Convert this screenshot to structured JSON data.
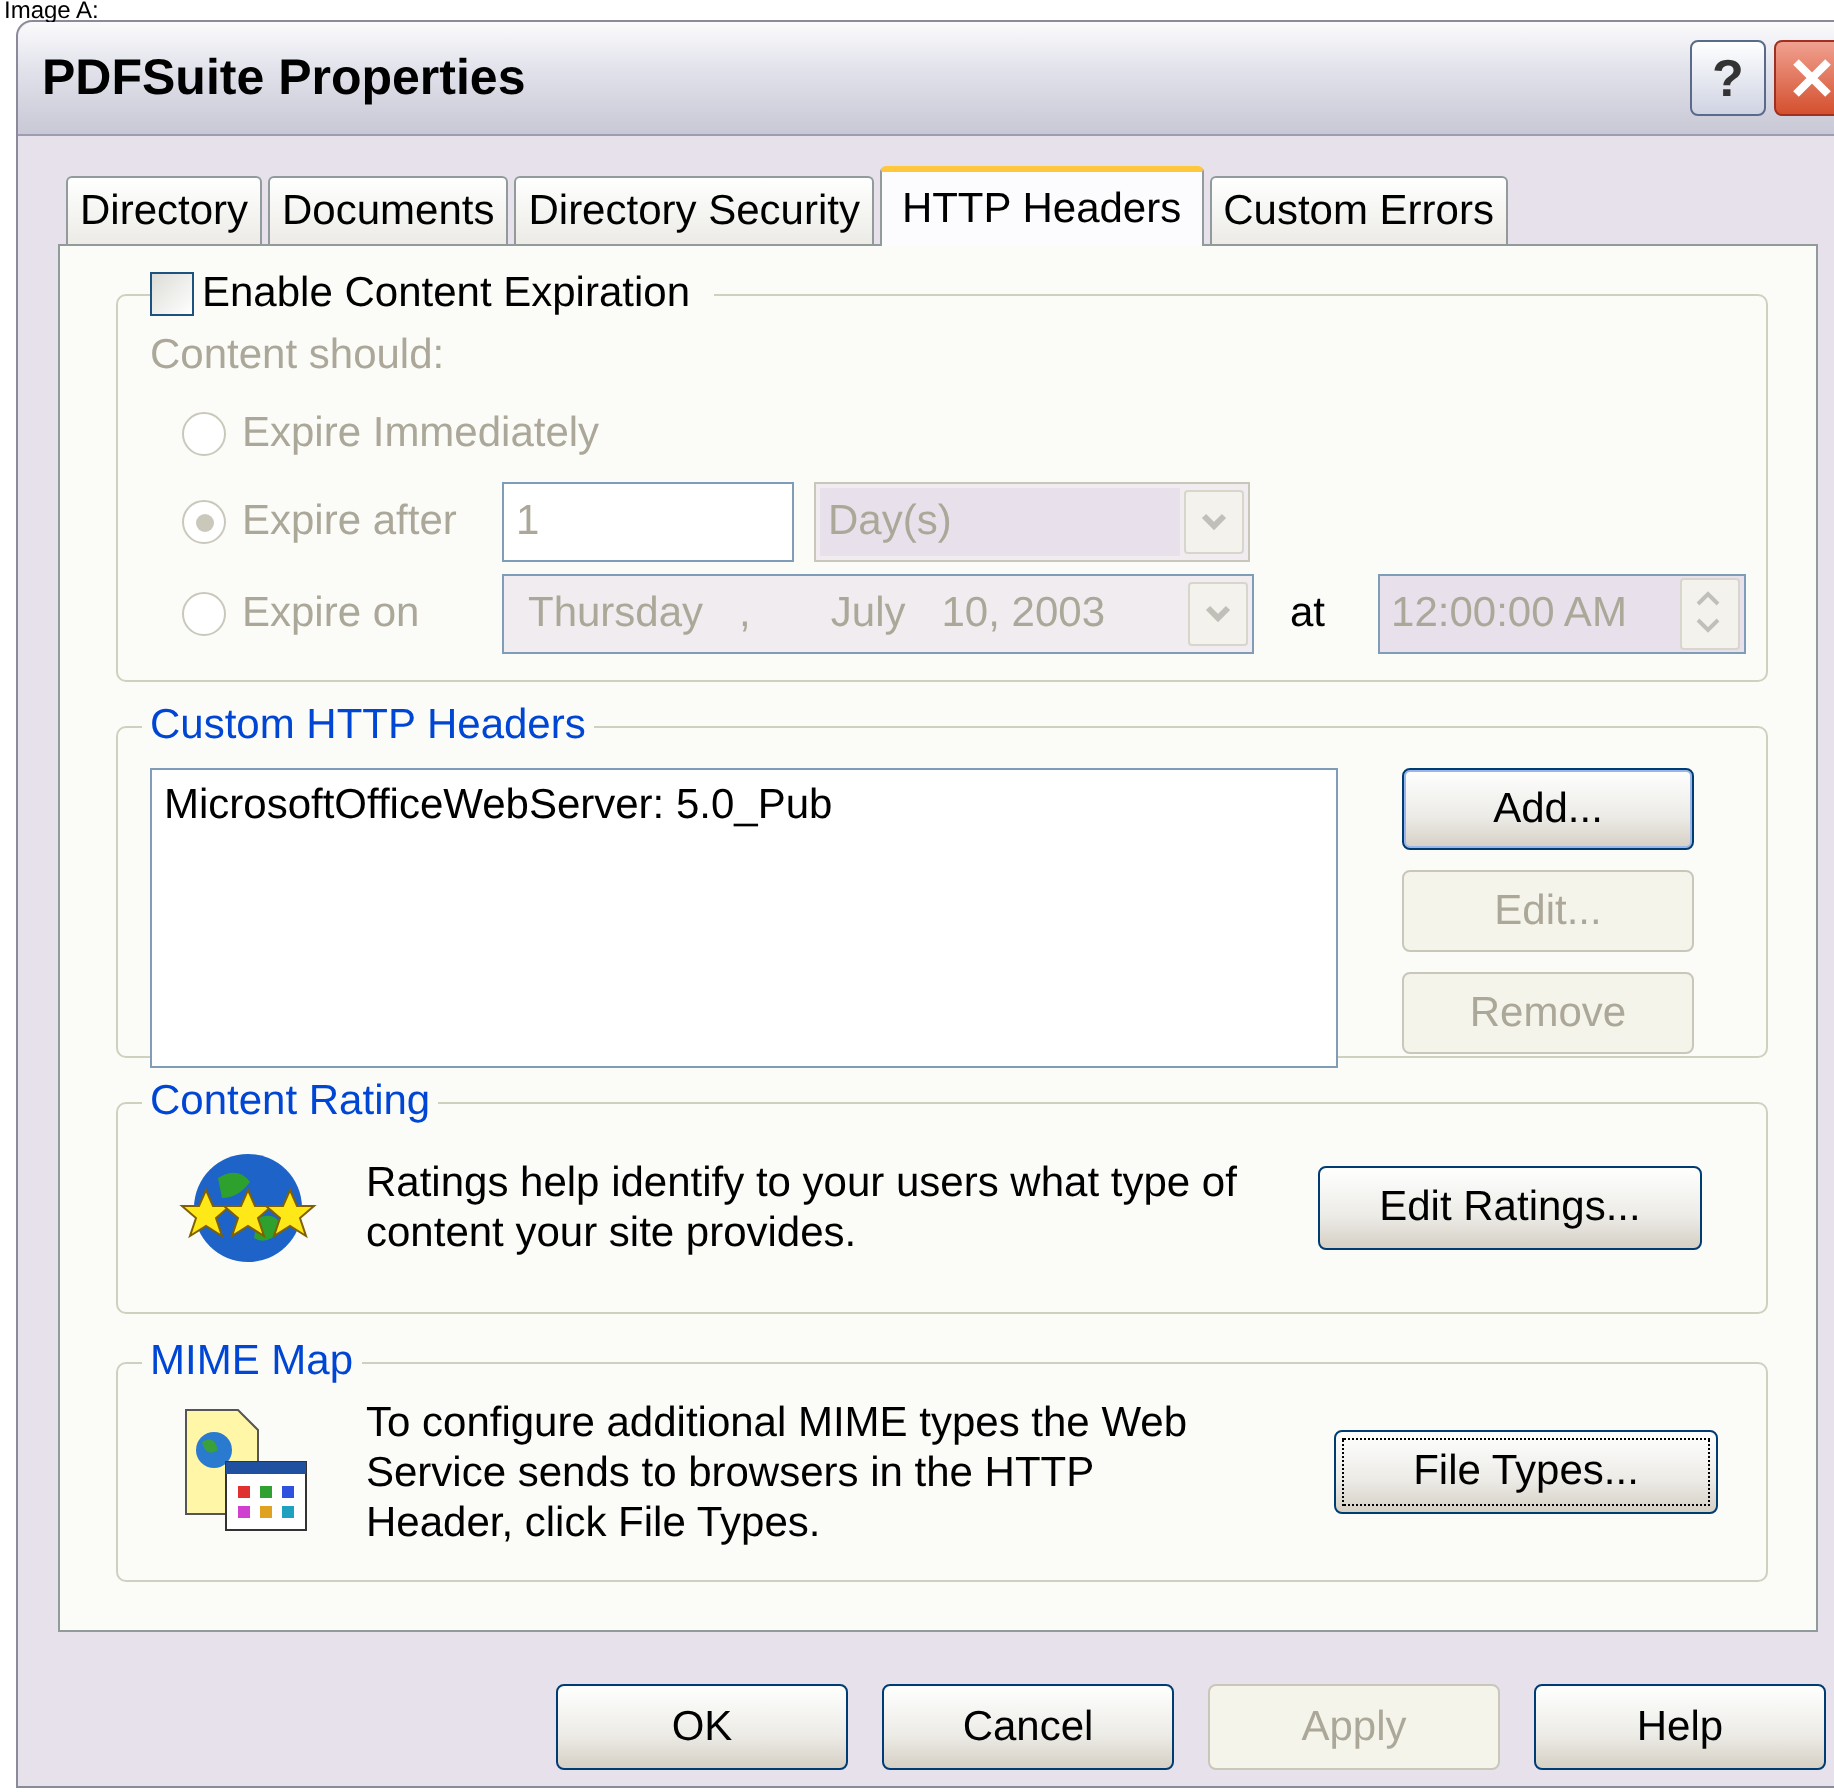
{
  "caption": "Image A:",
  "window": {
    "title": "PDFSuite Properties",
    "controls": [
      {
        "kind": "help",
        "label": "?"
      },
      {
        "kind": "close"
      }
    ]
  },
  "tabs": [
    {
      "label": "Directory",
      "selected": false
    },
    {
      "label": "Documents",
      "selected": false
    },
    {
      "label": "Directory Security",
      "selected": false
    },
    {
      "label": "HTTP Headers",
      "selected": true
    },
    {
      "label": "Custom Errors",
      "selected": false
    }
  ],
  "expiration": {
    "label": "Enable Content Expiration",
    "checked": false,
    "prompt": "Content should:",
    "disabled": true,
    "options": [
      {
        "kind": "plain",
        "label": "Expire Immediately",
        "selected": false
      },
      {
        "kind": "after",
        "label": "Expire after",
        "selected": true,
        "value": "1",
        "unit": "Day(s)"
      },
      {
        "kind": "on",
        "label": "Expire on",
        "selected": false,
        "date": [
          "Thursday",
          ",",
          "July",
          "10, 2003"
        ],
        "at": "at",
        "time": "12:00:00 AM"
      }
    ]
  },
  "headers": {
    "legend": "Custom HTTP Headers",
    "items": [
      "MicrosoftOfficeWebServer: 5.0_Pub"
    ],
    "buttons": [
      {
        "label": "Add...",
        "disabled": false,
        "default": true
      },
      {
        "label": "Edit...",
        "disabled": true,
        "default": false
      },
      {
        "label": "Remove",
        "disabled": true,
        "default": false
      }
    ]
  },
  "rating": {
    "legend": "Content Rating",
    "text": "Ratings help identify to your users what type of content your site provides.",
    "button": {
      "label": "Edit Ratings...",
      "focused": false
    }
  },
  "mime": {
    "legend": "MIME Map",
    "text": "To configure additional MIME types the Web Service sends to browsers in the HTTP Header, click File Types.",
    "button": {
      "label": "File Types...",
      "focused": true
    }
  },
  "footer": [
    {
      "label": "OK",
      "disabled": false
    },
    {
      "label": "Cancel",
      "disabled": false
    },
    {
      "label": "Apply",
      "disabled": true
    },
    {
      "label": "Help",
      "disabled": false
    }
  ]
}
